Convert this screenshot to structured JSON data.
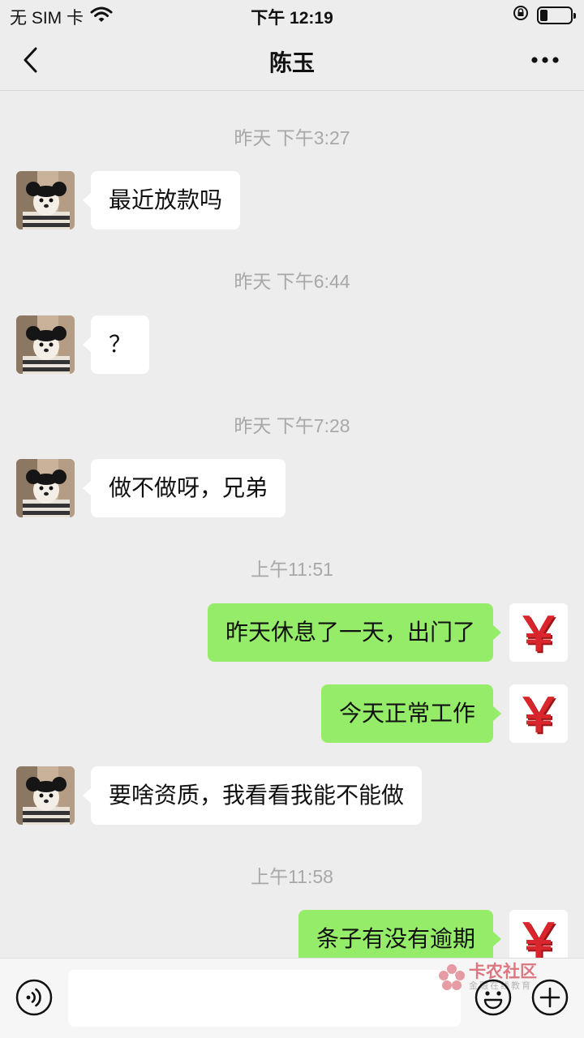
{
  "status_bar": {
    "carrier": "无 SIM 卡",
    "time": "下午 12:19",
    "battery_level": 0.25
  },
  "nav": {
    "title": "陈玉",
    "back_icon": "chevron-left-icon",
    "more_icon": "more-dots-icon"
  },
  "colors": {
    "background": "#ededed",
    "incoming_bubble": "#ffffff",
    "outgoing_bubble": "#95ec69",
    "timestamp_text": "#a8a8a8",
    "yuan_red": "#d9262c"
  },
  "messages": [
    {
      "type": "timestamp",
      "text": "昨天 下午3:27"
    },
    {
      "type": "incoming",
      "text": "最近放款吗"
    },
    {
      "type": "timestamp",
      "text": "昨天 下午6:44"
    },
    {
      "type": "incoming",
      "text": "？"
    },
    {
      "type": "timestamp",
      "text": "昨天 下午7:28"
    },
    {
      "type": "incoming",
      "text": "做不做呀，兄弟"
    },
    {
      "type": "timestamp",
      "text": "上午11:51"
    },
    {
      "type": "outgoing",
      "text": "昨天休息了一天，出门了"
    },
    {
      "type": "outgoing",
      "text": "今天正常工作"
    },
    {
      "type": "incoming",
      "text": "要啥资质，我看看我能不能做"
    },
    {
      "type": "timestamp",
      "text": "上午11:58"
    },
    {
      "type": "outgoing",
      "text": "条子有没有逾期"
    }
  ],
  "avatars": {
    "contact": "panda-dog-avatar",
    "self": "yuan-symbol-avatar",
    "self_glyph": "￥"
  },
  "input_bar": {
    "voice_icon": "voice-icon",
    "emoji_icon": "emoji-icon",
    "plus_icon": "plus-icon",
    "watermark_title": "卡农社区",
    "watermark_sub": "金融在线教育"
  }
}
